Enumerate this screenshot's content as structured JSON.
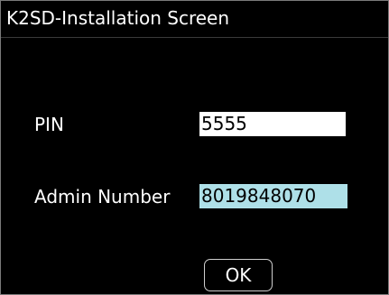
{
  "window": {
    "title": "K2SD-Installation Screen"
  },
  "form": {
    "pin": {
      "label": "PIN",
      "value": "5555"
    },
    "admin_number": {
      "label": "Admin Number",
      "value": "8019848070",
      "highlight_color": "#aee0e8"
    }
  },
  "actions": {
    "ok_label": "OK"
  }
}
